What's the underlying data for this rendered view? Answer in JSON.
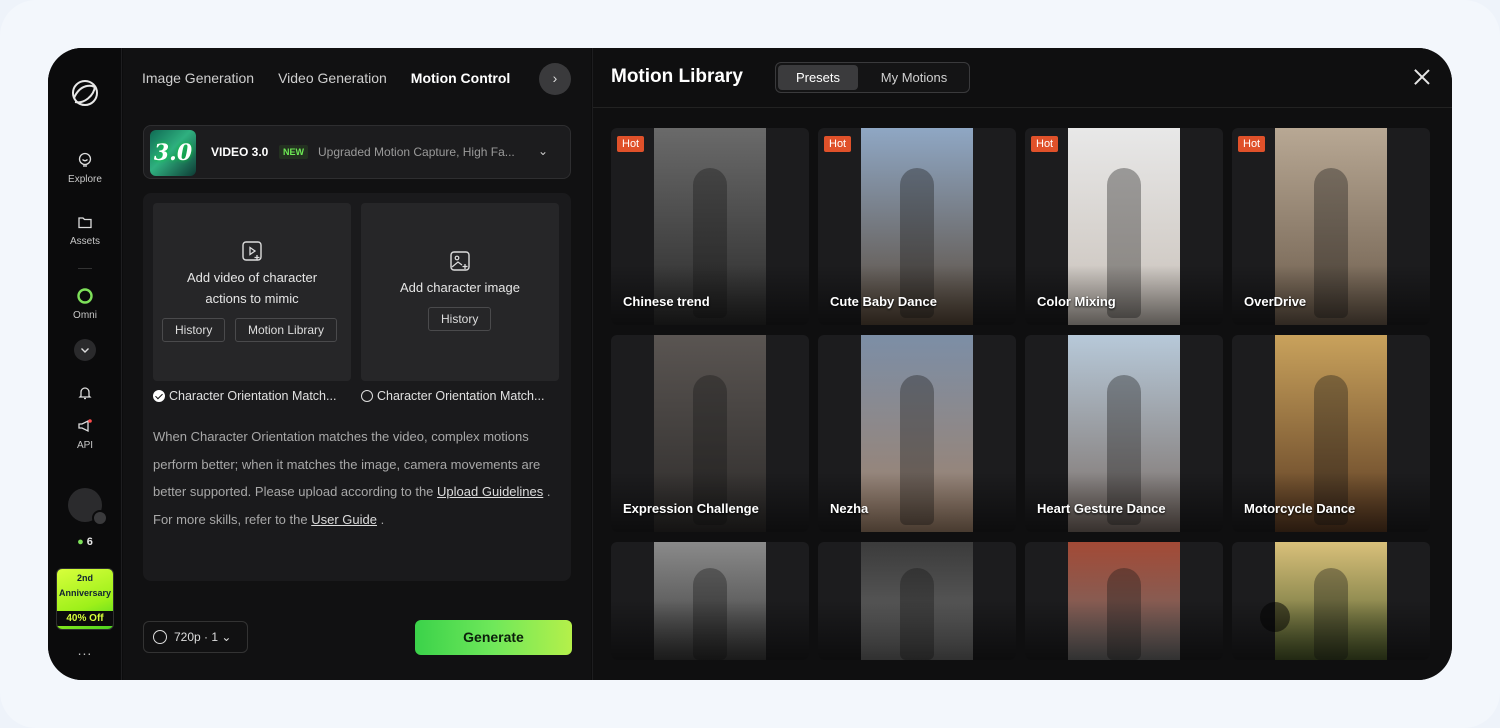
{
  "rail": {
    "items": [
      {
        "label": "Explore",
        "icon": "explore-icon"
      },
      {
        "label": "Assets",
        "icon": "folder-icon"
      },
      {
        "label": "Omni",
        "icon": "omni-icon"
      },
      {
        "label": "API",
        "icon": "megaphone-icon"
      }
    ],
    "credits": "6",
    "promo": {
      "line1": "2nd",
      "line2": "Anniversary",
      "line3": "40% Off"
    },
    "more": "..."
  },
  "tabs": [
    "Image Generation",
    "Video Generation",
    "Motion Control"
  ],
  "tabs_next": "›",
  "model": {
    "thumb": "3.0",
    "name": "VIDEO 3.0",
    "badge": "NEW",
    "desc": "Upgraded Motion Capture, High Fa...",
    "chevron": "⌄"
  },
  "upload": {
    "video_line1": "Add video of character",
    "video_line2": "actions to mimic",
    "video_history": "History",
    "video_library": "Motion Library",
    "image_text": "Add character image",
    "image_history": "History",
    "orient_video": "Character Orientation Match...",
    "orient_image": "Character Orientation Match..."
  },
  "help": {
    "p1": "When Character Orientation matches the video, complex motions perform better; when it matches the image, camera movements are better supported. Please upload according to the ",
    "link1": "Upload Guidelines",
    "p2": " . For more skills, refer to the ",
    "link2": "User Guide",
    "p3": " ."
  },
  "resolution": "720p · 1 ⌄",
  "generate_label": "Generate",
  "library": {
    "title": "Motion Library",
    "tabs": [
      "Presets",
      "My Motions"
    ],
    "active_tab": "Presets",
    "cards": [
      {
        "title": "Chinese trend",
        "hot": "Hot"
      },
      {
        "title": "Cute Baby Dance",
        "hot": "Hot"
      },
      {
        "title": "Color Mixing",
        "hot": "Hot"
      },
      {
        "title": "OverDrive",
        "hot": "Hot"
      },
      {
        "title": "Expression Challenge",
        "hot": ""
      },
      {
        "title": "Nezha",
        "hot": ""
      },
      {
        "title": "Heart Gesture Dance",
        "hot": ""
      },
      {
        "title": "Motorcycle Dance",
        "hot": ""
      },
      {
        "title": "",
        "hot": ""
      },
      {
        "title": "",
        "hot": ""
      },
      {
        "title": "",
        "hot": ""
      },
      {
        "title": "",
        "hot": ""
      }
    ]
  },
  "colors": {
    "accent": "#5fe04f",
    "hot": "#e0512a",
    "bg": "#0c0c0d"
  }
}
